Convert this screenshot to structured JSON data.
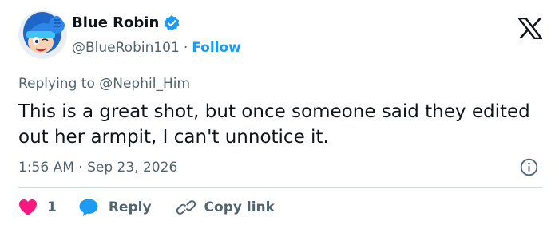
{
  "author": {
    "display_name": "Blue Robin",
    "handle": "@BlueRobin101",
    "separator": "·",
    "follow_label": "Follow",
    "verified": true
  },
  "reply_to": {
    "prefix": "Replying to",
    "handle": "@Nephil_Him"
  },
  "tweet": {
    "text": "This is a great shot, but once someone said they edited out her armpit, I can't unnotice it."
  },
  "meta": {
    "time": "1:56 AM",
    "separator": "·",
    "date": "Sep 23, 2026"
  },
  "actions": {
    "like_count": "1",
    "reply_label": "Reply",
    "copy_link_label": "Copy link"
  },
  "colors": {
    "link_blue": "#1d9bf0",
    "like_red": "#f91880",
    "secondary_text": "#536471",
    "divider": "#cfd9de"
  },
  "icons": {
    "brand": "x-logo-icon",
    "verified": "verified-badge-icon",
    "info": "info-icon",
    "like": "heart-icon",
    "reply": "speech-bubble-icon",
    "copy": "link-icon"
  }
}
